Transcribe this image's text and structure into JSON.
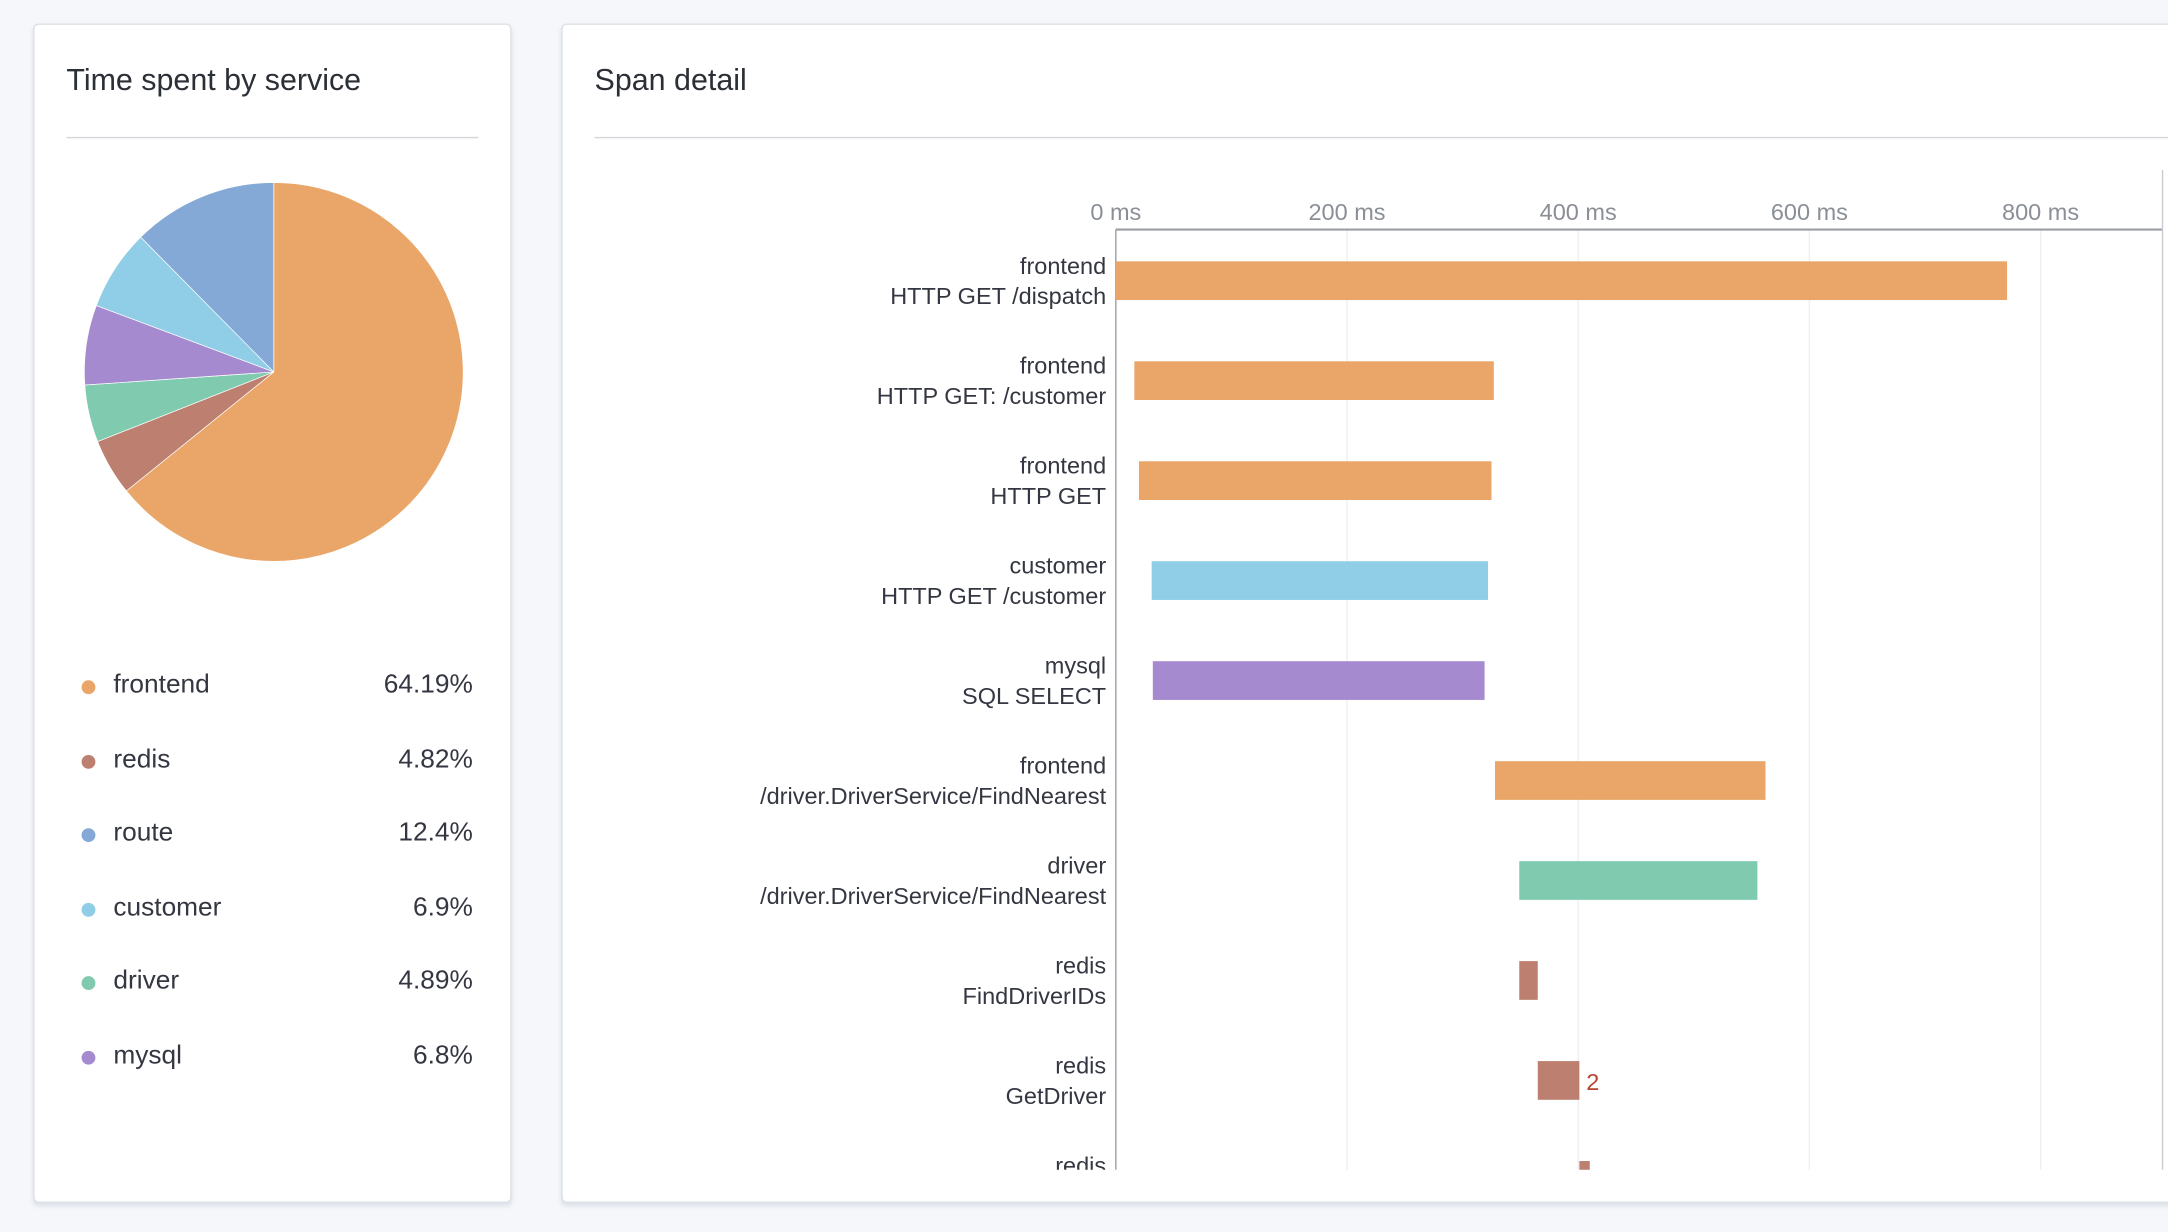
{
  "left_panel": {
    "title": "Time spent by service"
  },
  "right_panel": {
    "title": "Span detail"
  },
  "chart_data": [
    {
      "type": "pie",
      "slices": [
        {
          "label": "frontend",
          "value": 64.19,
          "display": "64.19%",
          "color": "#E9A668"
        },
        {
          "label": "redis",
          "value": 4.82,
          "display": "4.82%",
          "color": "#BC7F70"
        },
        {
          "label": "route",
          "value": 12.4,
          "display": "12.4%",
          "color": "#84A9D6"
        },
        {
          "label": "customer",
          "value": 6.9,
          "display": "6.9%",
          "color": "#90CDE7"
        },
        {
          "label": "driver",
          "value": 4.89,
          "display": "4.89%",
          "color": "#80CAAF"
        },
        {
          "label": "mysql",
          "value": 6.8,
          "display": "6.8%",
          "color": "#A68ACF"
        }
      ],
      "clockwise_order_from_top": [
        "frontend",
        "redis",
        "driver",
        "mysql",
        "customer",
        "route"
      ],
      "legend_placement": "bottom"
    },
    {
      "type": "bar",
      "orientation": "horizontal-range",
      "xlim": [
        0,
        900
      ],
      "x_ticks": [
        "0 ms",
        "200 ms",
        "400 ms",
        "600 ms",
        "800 ms"
      ],
      "x_tick_values": [
        0,
        200,
        400,
        600,
        800
      ],
      "grid": true,
      "rows": [
        {
          "service": "frontend",
          "operation": "HTTP GET /dispatch",
          "start": 0,
          "end": 771,
          "color": "#E9A668"
        },
        {
          "service": "frontend",
          "operation": "HTTP GET: /customer",
          "start": 16,
          "end": 327,
          "color": "#E9A668"
        },
        {
          "service": "frontend",
          "operation": "HTTP GET",
          "start": 20,
          "end": 325,
          "color": "#E9A668"
        },
        {
          "service": "customer",
          "operation": "HTTP GET /customer",
          "start": 31,
          "end": 322,
          "color": "#90CDE7"
        },
        {
          "service": "mysql",
          "operation": "SQL SELECT",
          "start": 32,
          "end": 319,
          "color": "#A68ACF"
        },
        {
          "service": "frontend",
          "operation": "/driver.DriverService/FindNearest",
          "start": 328,
          "end": 562,
          "color": "#E9A668"
        },
        {
          "service": "driver",
          "operation": "/driver.DriverService/FindNearest",
          "start": 349,
          "end": 555,
          "color": "#80CAAF"
        },
        {
          "service": "redis",
          "operation": "FindDriverIDs",
          "start": 349,
          "end": 365,
          "color": "#BC7F70"
        },
        {
          "service": "redis",
          "operation": "GetDriver",
          "start": 365,
          "end": 401,
          "color": "#BC7F70",
          "annotation": "2"
        },
        {
          "service": "redis",
          "operation": "",
          "start": 401,
          "end": 410,
          "color": "#BC7F70"
        }
      ]
    }
  ]
}
